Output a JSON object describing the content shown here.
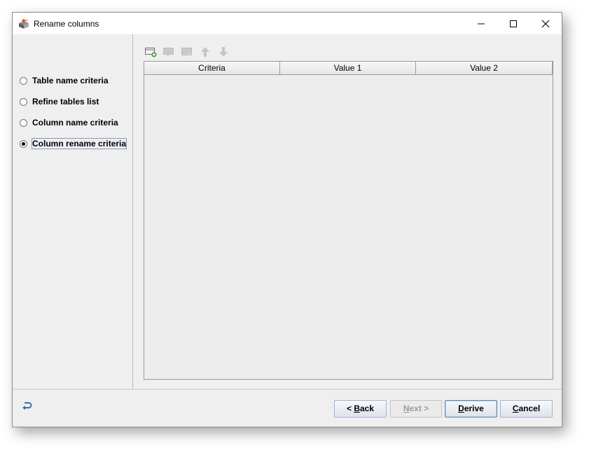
{
  "window": {
    "title": "Rename columns",
    "icon": "wizard-app-icon",
    "controls": [
      "minimize-icon",
      "maximize-icon",
      "close-icon"
    ]
  },
  "steps": [
    {
      "label": "Table name criteria",
      "selected": false
    },
    {
      "label": "Refine tables list",
      "selected": false
    },
    {
      "label": "Column name criteria",
      "selected": false
    },
    {
      "label": "Column rename criteria",
      "selected": true
    }
  ],
  "toolbar": {
    "icons": [
      "add-row-icon",
      "edit-row-icon",
      "remove-row-icon",
      "move-up-icon",
      "move-down-icon"
    ]
  },
  "table": {
    "columns": [
      "Criteria",
      "Value 1",
      "Value 2"
    ],
    "rows": []
  },
  "footer": {
    "undo_icon": "undo-icon",
    "back": {
      "prefix": "< ",
      "mnemonic": "B",
      "rest": "ack"
    },
    "next": {
      "mnemonic": "N",
      "rest": "ext >"
    },
    "derive": {
      "mnemonic": "D",
      "rest": "erive"
    },
    "cancel": {
      "mnemonic": "C",
      "rest": "ancel"
    }
  },
  "colors": {
    "window_bg": "#efefef",
    "titlebar_bg": "#ffffff",
    "focus_border": "#7a9ccc",
    "button_border": "#9fb4cf"
  }
}
